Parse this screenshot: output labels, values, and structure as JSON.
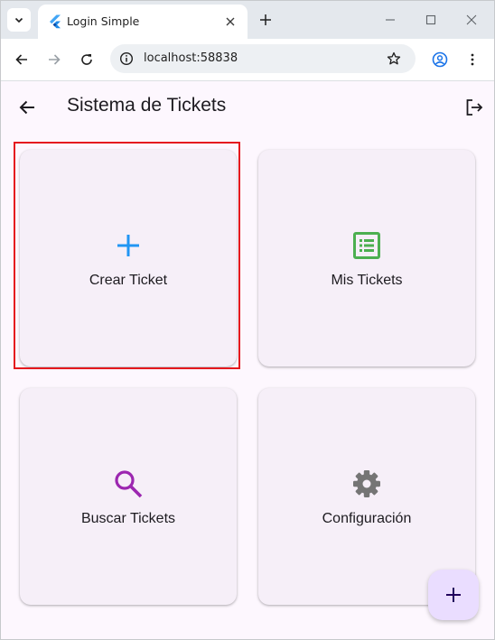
{
  "browser": {
    "tab_title": "Login Simple",
    "url": "localhost:58838",
    "icons": {
      "tab_dropdown": "chevron-down-icon",
      "favicon": "flutter-icon",
      "tab_close": "close-icon",
      "new_tab": "plus-icon",
      "minimize": "minimize-icon",
      "maximize": "maximize-icon",
      "close_window": "close-icon",
      "back": "arrow-left-icon",
      "forward": "arrow-right-icon",
      "reload": "reload-icon",
      "site_info": "site-info-icon",
      "bookmark": "star-icon",
      "profile": "account-icon",
      "menu": "more-vertical-icon"
    }
  },
  "app": {
    "title": "Sistema de Tickets",
    "icons": {
      "back": "arrow-left-icon",
      "logout": "logout-icon"
    },
    "cards": [
      {
        "label": "Crear Ticket",
        "icon": "add-icon",
        "icon_color": "#2196f3",
        "highlighted": true
      },
      {
        "label": "Mis Tickets",
        "icon": "list-alt-icon",
        "icon_color": "#4caf50",
        "highlighted": false
      },
      {
        "label": "Buscar Tickets",
        "icon": "search-icon",
        "icon_color": "#9c27b0",
        "highlighted": false
      },
      {
        "label": "Configuración",
        "icon": "settings-icon",
        "icon_color": "#757575",
        "highlighted": false
      }
    ],
    "fab": {
      "icon": "add-icon"
    }
  },
  "colors": {
    "background": "#fdf7fe",
    "card_background": "#f6eff8",
    "fab_background": "#eaddff",
    "highlight_border": "#e5181e"
  }
}
